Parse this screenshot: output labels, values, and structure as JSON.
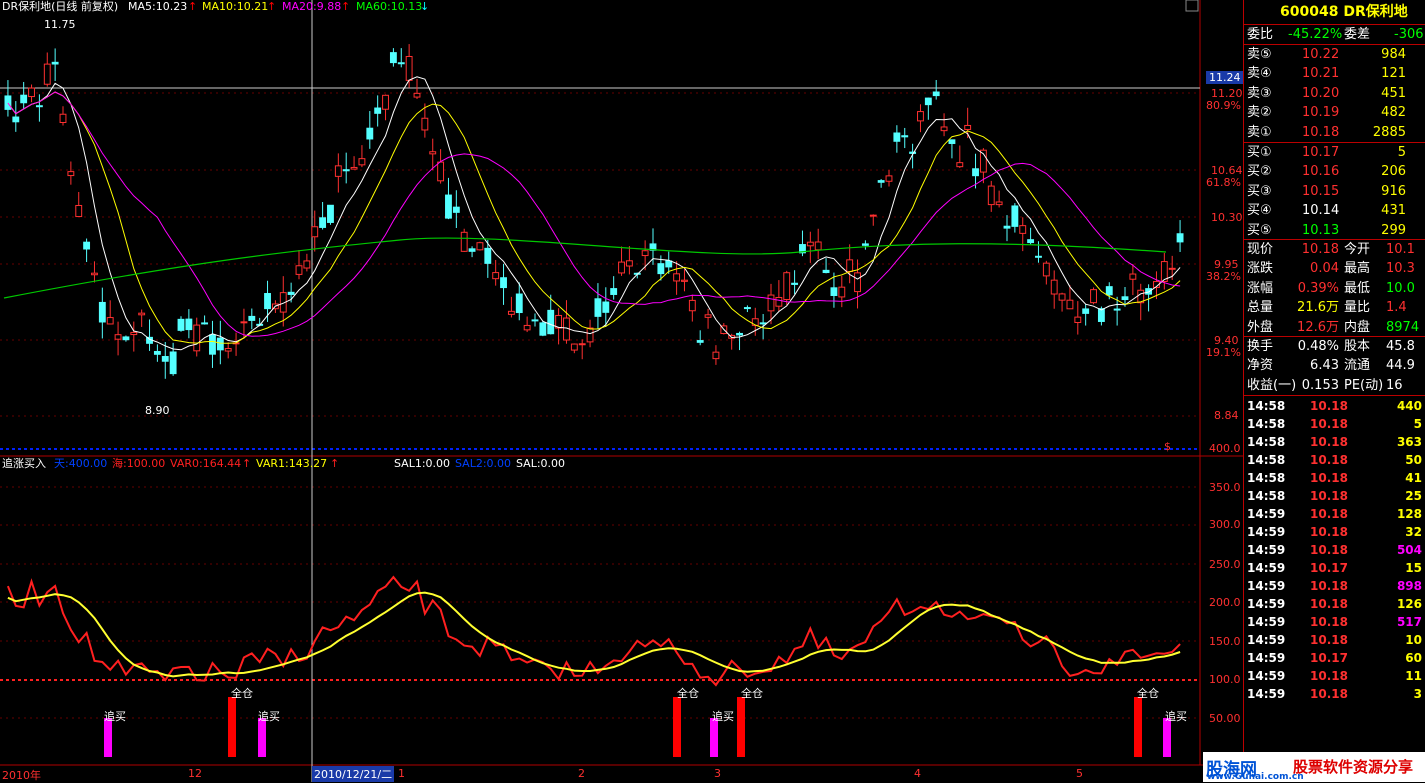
{
  "main_header": {
    "name": "DR保利地(日线 前复权)",
    "ma5": "MA5:10.23",
    "ma10": "MA10:10.21",
    "ma20": "MA20:9.88",
    "ma60": "MA60:10.13",
    "colors": {
      "ma5": "#ffffff",
      "ma10": "#ffff00",
      "ma20": "#ff00ff",
      "ma60": "#00ff00"
    }
  },
  "sub_header": {
    "name": "追涨买入",
    "tian": "天:400.00",
    "hai": "海:100.00",
    "var0": "VAR0:164.44",
    "var1": "VAR1:143.27",
    "sal1": "SAL1:0.00",
    "sal2": "SAL2:0.00",
    "sal": "SAL:0.00"
  },
  "price_axis": {
    "cursor_price": "11.24",
    "labels": [
      "11.20",
      "80.9%",
      "10.64",
      "61.8%",
      "10.30",
      "9.95",
      "38.2%",
      "9.40",
      "19.1%",
      "8.84"
    ],
    "dollar": "$"
  },
  "indicator_axis": {
    "labels": [
      "400.0",
      "350.0",
      "300.0",
      "250.0",
      "200.0",
      "150.0",
      "100.0",
      "50.00"
    ]
  },
  "annotations": {
    "high": "11.75",
    "low": "8.90",
    "buy_signal": "追买",
    "full_position": "全仓"
  },
  "date_axis": {
    "labels": [
      "2010年",
      "12",
      "2010/12/21/二",
      "1",
      "2",
      "3",
      "4",
      "5"
    ]
  },
  "side_panel": {
    "title": "600048 DR保利地",
    "wei_bi_label": "委比",
    "wei_bi_value": "-45.22%",
    "wei_cha_label": "委差",
    "wei_cha_value": "-306",
    "asks": [
      {
        "label": "卖⑤",
        "price": "10.22",
        "vol": "984"
      },
      {
        "label": "卖④",
        "price": "10.21",
        "vol": "121"
      },
      {
        "label": "卖③",
        "price": "10.20",
        "vol": "451"
      },
      {
        "label": "卖②",
        "price": "10.19",
        "vol": "482"
      },
      {
        "label": "卖①",
        "price": "10.18",
        "vol": "2885"
      }
    ],
    "bids": [
      {
        "label": "买①",
        "price": "10.17",
        "vol": "5"
      },
      {
        "label": "买②",
        "price": "10.16",
        "vol": "206"
      },
      {
        "label": "买③",
        "price": "10.15",
        "vol": "916"
      },
      {
        "label": "买④",
        "price": "10.14",
        "vol": "431"
      },
      {
        "label": "买⑤",
        "price": "10.13",
        "vol": "299"
      }
    ],
    "stats": [
      {
        "l1": "现价",
        "v1": "10.18",
        "l2": "今开",
        "v2": "10.1"
      },
      {
        "l1": "涨跌",
        "v1": "0.04",
        "l2": "最高",
        "v2": "10.3"
      },
      {
        "l1": "涨幅",
        "v1": "0.39%",
        "l2": "最低",
        "v2": "10.0"
      },
      {
        "l1": "总量",
        "v1": "21.6万",
        "l2": "量比",
        "v2": "1.4"
      },
      {
        "l1": "外盘",
        "v1": "12.6万",
        "l2": "内盘",
        "v2": "8974"
      }
    ],
    "stats2": [
      {
        "l1": "换手",
        "v1": "0.48%",
        "l2": "股本",
        "v2": "45.8"
      },
      {
        "l1": "净资",
        "v1": "6.43",
        "l2": "流通",
        "v2": "44.9"
      },
      {
        "l1": "收益(一)",
        "v1": "0.153",
        "l2": "PE(动)",
        "v2": "16"
      }
    ],
    "ticks": [
      {
        "time": "14:58",
        "price": "10.18",
        "vol": "440",
        "vc": "#ffff00"
      },
      {
        "time": "14:58",
        "price": "10.18",
        "vol": "5",
        "vc": "#ffff00"
      },
      {
        "time": "14:58",
        "price": "10.18",
        "vol": "363",
        "vc": "#ffff00"
      },
      {
        "time": "14:58",
        "price": "10.18",
        "vol": "50",
        "vc": "#ffff00"
      },
      {
        "time": "14:58",
        "price": "10.18",
        "vol": "41",
        "vc": "#ffff00"
      },
      {
        "time": "14:58",
        "price": "10.18",
        "vol": "25",
        "vc": "#ffff00"
      },
      {
        "time": "14:59",
        "price": "10.18",
        "vol": "128",
        "vc": "#ffff00"
      },
      {
        "time": "14:59",
        "price": "10.18",
        "vol": "32",
        "vc": "#ffff00"
      },
      {
        "time": "14:59",
        "price": "10.18",
        "vol": "504",
        "vc": "#ff00ff"
      },
      {
        "time": "14:59",
        "price": "10.17",
        "vol": "15",
        "vc": "#ffff00"
      },
      {
        "time": "14:59",
        "price": "10.18",
        "vol": "898",
        "vc": "#ff00ff"
      },
      {
        "time": "14:59",
        "price": "10.18",
        "vol": "126",
        "vc": "#ffff00"
      },
      {
        "time": "14:59",
        "price": "10.18",
        "vol": "517",
        "vc": "#ff00ff"
      },
      {
        "time": "14:59",
        "price": "10.18",
        "vol": "10",
        "vc": "#ffff00"
      },
      {
        "time": "14:59",
        "price": "10.17",
        "vol": "60",
        "vc": "#ffff00"
      },
      {
        "time": "14:59",
        "price": "10.18",
        "vol": "11",
        "vc": "#ffff00"
      },
      {
        "time": "14:59",
        "price": "10.18",
        "vol": "3",
        "vc": "#ffff00"
      }
    ]
  },
  "watermark": {
    "brand": "股海网",
    "slogan": "股票软件资源分享",
    "url": "www.Guhai.com.cn"
  }
}
